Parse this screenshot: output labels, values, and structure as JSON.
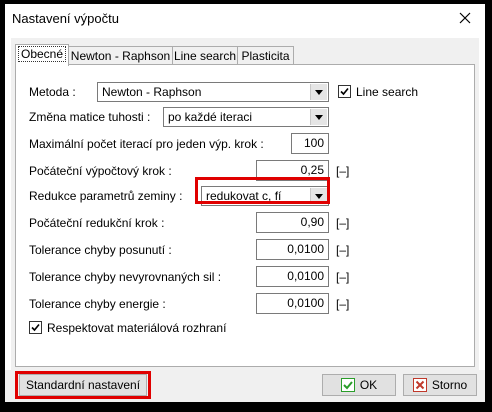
{
  "window": {
    "title": "Nastavení výpočtu",
    "close_symbol": "✕"
  },
  "tabs": [
    {
      "label": "Obecné",
      "active": true
    },
    {
      "label": "Newton - Raphson",
      "active": false
    },
    {
      "label": "Line search",
      "active": false
    },
    {
      "label": "Plasticita",
      "active": false
    }
  ],
  "form": {
    "method_label": "Metoda :",
    "method_value": "Newton - Raphson",
    "line_search_label": "Line search",
    "line_search_checked": true,
    "stiffness_label": "Změna matice tuhosti :",
    "stiffness_value": "po každé iteraci",
    "max_iter_label": "Maximální počet iterací pro jeden výp. krok :",
    "max_iter_value": "100",
    "init_step_label": "Počáteční výpočtový krok :",
    "init_step_value": "0,25",
    "init_step_unit": "[–]",
    "reduction_label": "Redukce parametrů zeminy :",
    "reduction_value": "redukovat c, fí",
    "init_red_step_label": "Počáteční redukční krok :",
    "init_red_step_value": "0,90",
    "init_red_step_unit": "[–]",
    "tol_disp_label": "Tolerance chyby posunutí :",
    "tol_disp_value": "0,0100",
    "tol_disp_unit": "[–]",
    "tol_unbal_label": "Tolerance chyby nevyrovnaných sil :",
    "tol_unbal_value": "0,0100",
    "tol_unbal_unit": "[–]",
    "tol_energy_label": "Tolerance chyby energie :",
    "tol_energy_value": "0,0100",
    "tol_energy_unit": "[–]",
    "respect_label": "Respektovat materiálová rozhraní",
    "respect_checked": true
  },
  "footer": {
    "default_label": "Standardní nastavení",
    "ok_label": "OK",
    "cancel_label": "Storno"
  },
  "colors": {
    "highlight": "#e00000",
    "ok_icon": "#2a9d2a",
    "cancel_icon": "#c0392b"
  }
}
